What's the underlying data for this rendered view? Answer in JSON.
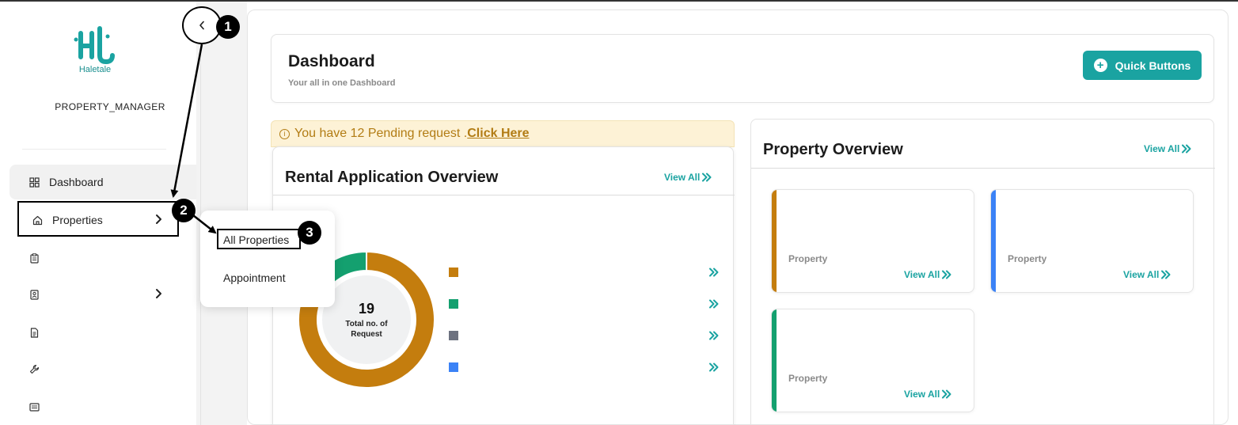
{
  "brand": {
    "name": "Haletale",
    "color": "#1aa3a1"
  },
  "sidebar": {
    "role": "PROPERTY_MANAGER",
    "items": [
      {
        "label": "Dashboard",
        "icon": "dashboard-icon"
      },
      {
        "label": "Properties",
        "icon": "home-icon"
      },
      {
        "label": "",
        "icon": "clipboard-icon"
      },
      {
        "label": "",
        "icon": "contacts-book-icon"
      },
      {
        "label": "",
        "icon": "document-icon"
      },
      {
        "label": "",
        "icon": "wrench-icon"
      },
      {
        "label": "",
        "icon": "list-card-icon"
      }
    ]
  },
  "submenu": {
    "items": [
      "All Properties",
      "Appointment"
    ]
  },
  "header": {
    "title": "Dashboard",
    "subtitle": "Your all in one Dashboard",
    "quick_buttons_label": "Quick Buttons"
  },
  "pending": {
    "text": "You have 12 Pending request .",
    "link": "Click Here"
  },
  "rental": {
    "title": "Rental Application Overview",
    "view_all": "View All",
    "total": "19",
    "total_label": "Total no. of Request",
    "legend_colors": [
      "#c47d0e",
      "#14a06f",
      "#6d7280",
      "#3b82f6"
    ]
  },
  "chart_data": {
    "type": "pie",
    "categories": [
      "",
      ""
    ],
    "values": [
      16,
      3
    ],
    "colors": [
      "#c47d0e",
      "#14a06f"
    ],
    "title": "",
    "center_text": "19 Total no. of Request"
  },
  "property_overview": {
    "title": "Property Overview",
    "view_all": "View All",
    "tiles": [
      {
        "label": "Property",
        "view_all": "View All",
        "color": "#c47d0e"
      },
      {
        "label": "Property",
        "view_all": "View All",
        "color": "#3b82f6"
      },
      {
        "label": "Property",
        "view_all": "View All",
        "color": "#14a06f"
      }
    ]
  },
  "steps": [
    "1",
    "2",
    "3"
  ]
}
